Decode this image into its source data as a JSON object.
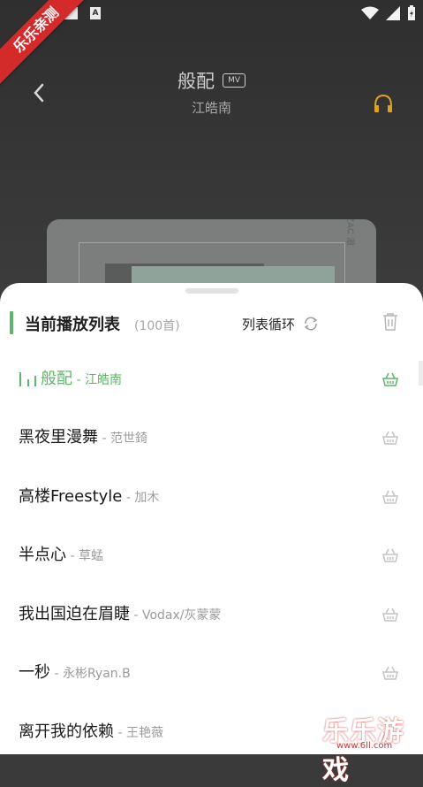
{
  "status_bar": {
    "app_label": "A"
  },
  "ribbon": {
    "text": "乐乐亲测"
  },
  "header": {
    "title": "般配",
    "mv_label": "MV",
    "artist": "江皓南"
  },
  "album": {
    "cover_text": "ZAC 澈"
  },
  "playlist": {
    "title": "当前播放列表",
    "count": "(100首)",
    "loop_mode": "列表循环",
    "items": [
      {
        "title": "般配",
        "artist": "江皓南",
        "active": true
      },
      {
        "title": "黑夜里漫舞",
        "artist": "范世錡"
      },
      {
        "title": "高楼Freestyle",
        "artist": "加木"
      },
      {
        "title": "半点心",
        "artist": "草蜢"
      },
      {
        "title": "我出国迫在眉睫",
        "artist": "Vodax/灰蒙蒙"
      },
      {
        "title": "一秒",
        "artist": "永彬Ryan.B"
      },
      {
        "title": "离开我的依赖",
        "artist": "王艳薇"
      }
    ]
  },
  "watermark": {
    "text": "乐乐游戏",
    "url": "www.6ll.com"
  },
  "colors": {
    "accent": "#5fb56a",
    "headphone": "#e0a020"
  }
}
